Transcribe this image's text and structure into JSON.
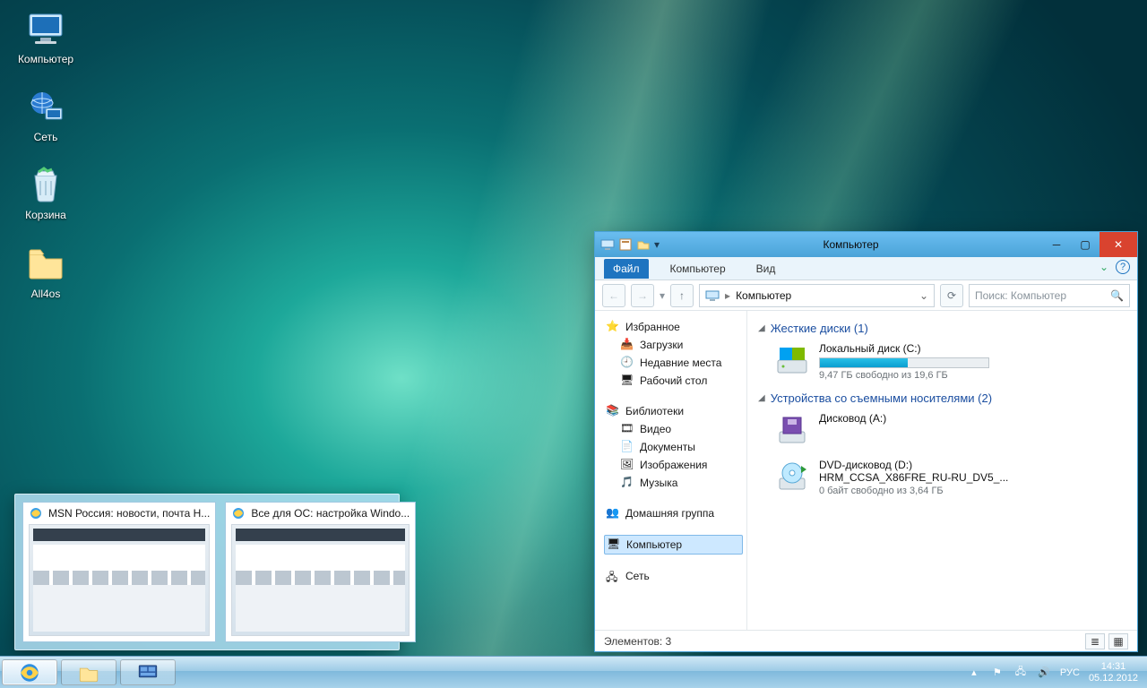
{
  "desktop": {
    "icons": [
      {
        "name": "computer",
        "label": "Компьютер"
      },
      {
        "name": "network",
        "label": "Сеть"
      },
      {
        "name": "recycle",
        "label": "Корзина"
      },
      {
        "name": "folder",
        "label": "All4os"
      }
    ]
  },
  "thumbnails": {
    "items": [
      {
        "title": "MSN Россия: новости, почта H..."
      },
      {
        "title": "Все для ОС: настройка Windo..."
      }
    ]
  },
  "taskbar": {
    "buttons": [
      "internet-explorer",
      "file-explorer",
      "desktop-preview"
    ],
    "tray": {
      "flag": "▏",
      "action_center": "⚑",
      "network": "🖧",
      "volume": "🔊",
      "lang": "РУС",
      "time": "14:31",
      "date": "05.12.2012"
    }
  },
  "explorer": {
    "window_title": "Компьютер",
    "ribbon": {
      "file": "Файл",
      "tabs": [
        "Компьютер",
        "Вид"
      ]
    },
    "nav": {
      "breadcrumb_root_icon": "computer",
      "breadcrumb": "Компьютер",
      "search_placeholder": "Поиск: Компьютер"
    },
    "navpane": {
      "favorites": {
        "label": "Избранное",
        "items": [
          "Загрузки",
          "Недавние места",
          "Рабочий стол"
        ]
      },
      "libraries": {
        "label": "Библиотеки",
        "items": [
          "Видео",
          "Документы",
          "Изображения",
          "Музыка"
        ]
      },
      "homegroup": "Домашняя группа",
      "computer": "Компьютер",
      "network": "Сеть"
    },
    "content": {
      "hard_drives": {
        "heading": "Жесткие диски (1)",
        "drive": {
          "name": "Локальный диск (C:)",
          "free_text": "9,47 ГБ свободно из 19,6 ГБ",
          "fill_percent": 52
        }
      },
      "removable": {
        "heading": "Устройства со съемными носителями (2)",
        "floppy": {
          "name": "Дисковод (A:)"
        },
        "dvd": {
          "name": "DVD-дисковод (D:)",
          "label2": "HRM_CCSA_X86FRE_RU-RU_DV5_...",
          "free_text": "0 байт свободно из 3,64 ГБ"
        }
      }
    },
    "statusbar": {
      "text": "Элементов: 3"
    }
  }
}
